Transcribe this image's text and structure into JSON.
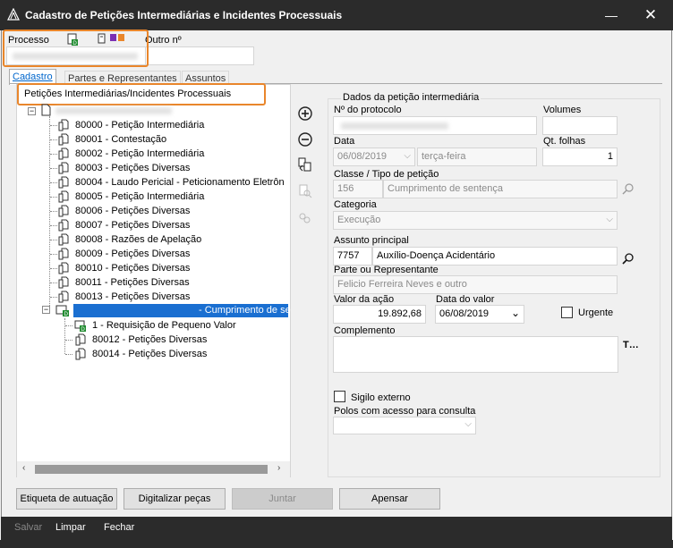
{
  "window": {
    "title": "Cadastro de Petições Intermediárias e Incidentes Processuais",
    "minimize_glyph": "—",
    "close_glyph": "✕"
  },
  "header": {
    "processo_label": "Processo",
    "outro_label": "Outro nº"
  },
  "tabs": [
    {
      "label": "Cadastro",
      "active": true
    },
    {
      "label": "Partes e Representantes",
      "active": false
    },
    {
      "label": "Assuntos",
      "active": false
    }
  ],
  "tree": {
    "section_title": "Petições Intermediárias/Incidentes Processuais",
    "items": [
      "80000 - Petição Intermediária",
      "80001 - Contestação",
      "80002 - Petição Intermediária",
      "80003 - Petições Diversas",
      "80004 - Laudo Pericial - Peticionamento Eletrôn",
      "80005 - Petição Intermediária",
      "80006 - Petições Diversas",
      "80007 - Petições Diversas",
      "80008 - Razões de Apelação",
      "80009 - Petições Diversas",
      "80010 - Petições Diversas",
      "80011 - Petições Diversas",
      "80013 - Petições Diversas"
    ],
    "selected_suffix": "- Cumprimento de se",
    "child_items": [
      "1 - Requisição de Pequeno Valor",
      "80012 - Petições Diversas",
      "80014 - Petições Diversas"
    ]
  },
  "form": {
    "group_title": "Dados da petição intermediária",
    "protocolo_label": "Nº do protocolo",
    "volumes_label": "Volumes",
    "volumes_value": "",
    "data_label": "Data",
    "data_value": "06/08/2019",
    "weekday_value": "terça-feira",
    "qt_folhas_label": "Qt. folhas",
    "qt_folhas_value": "1",
    "classe_label": "Classe / Tipo de petição",
    "classe_code": "156",
    "classe_value": "Cumprimento de sentença",
    "categoria_label": "Categoria",
    "categoria_value": "Execução",
    "assunto_label": "Assunto principal",
    "assunto_code": "7757",
    "assunto_value": "Auxílio-Doença Acidentário",
    "parte_label": "Parte ou Representante",
    "parte_value": "Felicio Ferreira Neves e outro",
    "valor_label": "Valor da ação",
    "valor_value": "19.892,68",
    "data_valor_label": "Data do valor",
    "data_valor_value": "06/08/2019",
    "urgente_label": "Urgente",
    "complemento_label": "Complemento",
    "complemento_value": "",
    "sigilo_label": "Sigilo externo",
    "polos_label": "Polos com acesso para consulta",
    "polos_value": ""
  },
  "buttons": {
    "etiqueta": "Etiqueta de autuação",
    "digitalizar": "Digitalizar peças",
    "juntar": "Juntar",
    "apensar": "Apensar"
  },
  "footer": {
    "salvar": "Salvar",
    "limpar": "Limpar",
    "fechar": "Fechar"
  },
  "colors": {
    "accent": "#1a6fd1",
    "highlight": "#e9862b",
    "titlebar": "#2b2b2b"
  }
}
